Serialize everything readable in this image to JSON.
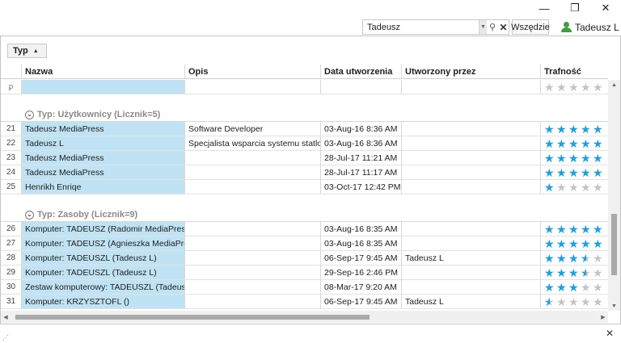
{
  "window": {
    "minimize": "—",
    "maximize": "❐",
    "close": "✕"
  },
  "toolbar": {
    "search_value": "Tadeusz",
    "scope_label": "Wszędzie",
    "user_name": "Tadeusz L"
  },
  "grid": {
    "group_chip": "Typ",
    "columns": [
      "Nazwa",
      "Opis",
      "Data utworzenia",
      "Utworzony przez",
      "Trafność"
    ],
    "filter_marker": "ꝑ",
    "groups": [
      {
        "header": "Typ: Użytkownicy (Licznik=5)",
        "rows": [
          {
            "num": "21",
            "name": "Tadeusz MediaPress",
            "desc": "Software Developer",
            "date": "03-Aug-16 8:36 AM",
            "by": "",
            "rating": 5
          },
          {
            "num": "22",
            "name": "Tadeusz L",
            "desc": "Specjalista wsparcia systemu statlook",
            "date": "03-Aug-16 8:36 AM",
            "by": "",
            "rating": 5
          },
          {
            "num": "23",
            "name": "Tadeusz MediaPress",
            "desc": "",
            "date": "28-Jul-17 11:21 AM",
            "by": "",
            "rating": 5
          },
          {
            "num": "24",
            "name": "Tadeusz MediaPress",
            "desc": "",
            "date": "28-Jul-17 11:17 AM",
            "by": "",
            "rating": 5
          },
          {
            "num": "25",
            "name": "Henrikh Enriqe",
            "desc": "",
            "date": "03-Oct-17 12:42 PM",
            "by": "",
            "rating": 1
          }
        ]
      },
      {
        "header": "Typ: Zasoby (Licznik=9)",
        "rows": [
          {
            "num": "26",
            "name": "Komputer: TADEUSZ (Radomir MediaPress)",
            "desc": "",
            "date": "03-Aug-16 8:35 AM",
            "by": "",
            "rating": 5
          },
          {
            "num": "27",
            "name": "Komputer: TADEUSZ (Agnieszka MediaPress)",
            "desc": "",
            "date": "03-Aug-16 8:35 AM",
            "by": "",
            "rating": 5
          },
          {
            "num": "28",
            "name": "Komputer: TADEUSZL (Tadeusz L)",
            "desc": "",
            "date": "06-Sep-17 9:45 AM",
            "by": "Tadeusz L",
            "rating": 3.5
          },
          {
            "num": "29",
            "name": "Komputer: TADEUSZL (Tadeusz L)",
            "desc": "",
            "date": "29-Sep-16 2:46 PM",
            "by": "",
            "rating": 3.5
          },
          {
            "num": "30",
            "name": "Zestaw komputerowy: TADEUSZL (Tadeusz L)",
            "desc": "",
            "date": "08-Mar-17 9:20 AM",
            "by": "",
            "rating": 3
          },
          {
            "num": "31",
            "name": "Komputer: KRZYSZTOFL ()",
            "desc": "",
            "date": "06-Sep-17 9:45 AM",
            "by": "Tadeusz L",
            "rating": 0.5
          }
        ]
      }
    ]
  },
  "colors": {
    "star_on": "#1ba1e2",
    "star_off": "#c4c4c4",
    "name_cell": "#bfe3f4"
  }
}
